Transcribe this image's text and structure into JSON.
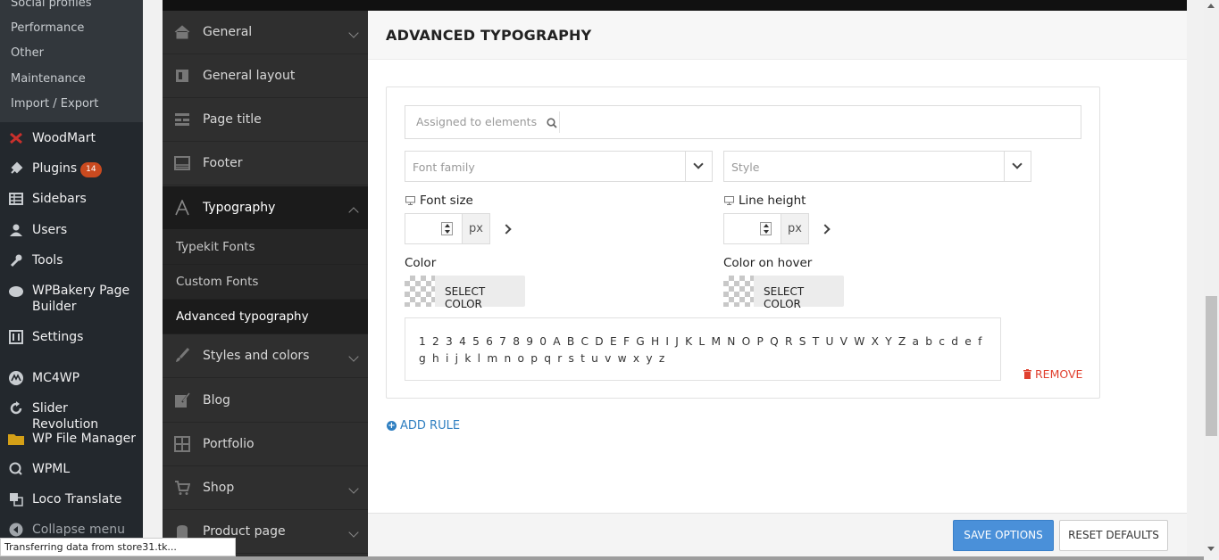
{
  "wp_submenu": [
    "Social profiles",
    "Performance",
    "Other",
    "Maintenance",
    "Import / Export"
  ],
  "wp_menu": [
    {
      "label": "WoodMart",
      "icon": "woodmart-icon"
    },
    {
      "label": "Plugins",
      "icon": "plugins-icon",
      "badge": "14"
    },
    {
      "label": "Sidebars",
      "icon": "sidebars-icon"
    },
    {
      "label": "Users",
      "icon": "users-icon"
    },
    {
      "label": "Tools",
      "icon": "tools-icon"
    },
    {
      "label": "WPBakery Page Builder",
      "icon": "wpbakery-icon"
    },
    {
      "label": "Settings",
      "icon": "settings-icon"
    },
    {
      "label": "MC4WP",
      "icon": "mc4wp-icon"
    },
    {
      "label": "Slider Revolution",
      "icon": "slider-revolution-icon"
    },
    {
      "label": "WP File Manager",
      "icon": "folder-icon"
    },
    {
      "label": "WPML",
      "icon": "wpml-icon"
    },
    {
      "label": "Loco Translate",
      "icon": "translate-icon"
    },
    {
      "label": "Collapse menu",
      "icon": "collapse-icon"
    }
  ],
  "settings_nav": {
    "items": [
      {
        "label": "General"
      },
      {
        "label": "General layout"
      },
      {
        "label": "Page title"
      },
      {
        "label": "Footer"
      },
      {
        "label": "Typography"
      },
      {
        "label": "Styles and colors"
      },
      {
        "label": "Blog"
      },
      {
        "label": "Portfolio"
      },
      {
        "label": "Shop"
      },
      {
        "label": "Product page"
      }
    ],
    "typography_sub": [
      "Typekit Fonts",
      "Custom Fonts",
      "Advanced typography"
    ]
  },
  "section": {
    "title": "ADVANCED TYPOGRAPHY"
  },
  "rule": {
    "assigned_placeholder": "Assigned to elements",
    "font_family_placeholder": "Font family",
    "style_placeholder": "Style",
    "font_size_label": "Font size",
    "line_height_label": "Line height",
    "unit": "px",
    "color_label": "Color",
    "color_hover_label": "Color on hover",
    "select_color": "SELECT COLOR",
    "preview": "1 2 3 4 5 6 7 8 9 0 A B C D E F G H I J K L M N O P Q R S T U V W X Y Z a b c d e f g h i j k l m n o p q r s t u v w x y z",
    "remove": "REMOVE"
  },
  "add_rule": "ADD RULE",
  "footer": {
    "save": "SAVE OPTIONS",
    "reset": "RESET DEFAULTS"
  },
  "status": "Transferring data from store31.tk...",
  "colors": {
    "accent": "#4a90d9",
    "danger": "#e0402f",
    "link": "#2f7fc1",
    "badge": "#ca4a1f"
  }
}
